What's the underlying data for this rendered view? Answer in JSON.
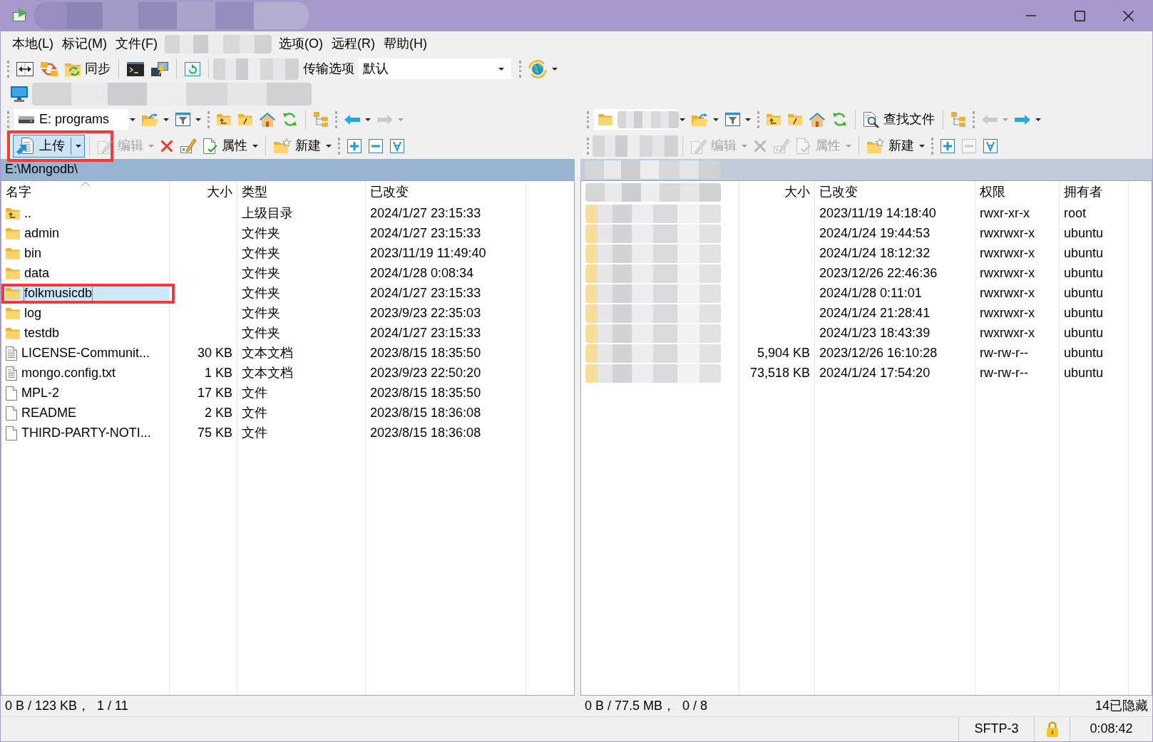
{
  "menu": [
    {
      "kind": "item",
      "label": "本地(L)"
    },
    {
      "kind": "item",
      "label": "标记(M)"
    },
    {
      "kind": "item",
      "label": "文件(F)"
    },
    {
      "kind": "redacted"
    },
    {
      "kind": "item",
      "label": "选项(O)"
    },
    {
      "kind": "item",
      "label": "远程(R)"
    },
    {
      "kind": "item",
      "label": "帮助(H)"
    }
  ],
  "main_toolbar": {
    "sync_label": "同步",
    "transfer_label": "传输选项",
    "transfer_preset": "默认"
  },
  "local_panel": {
    "active": true,
    "nav_toolbar": [
      {
        "kind": "drive",
        "label": "E: programs",
        "disabled": false
      },
      {
        "kind": "open",
        "disabled": false
      },
      {
        "kind": "filter",
        "disabled": false
      },
      {
        "kind": "parent",
        "disabled": false
      },
      {
        "kind": "root",
        "disabled": false
      },
      {
        "kind": "home",
        "disabled": false
      },
      {
        "kind": "refresh",
        "disabled": false
      },
      {
        "kind": "tree",
        "disabled": false
      },
      {
        "kind": "back",
        "disabled": false
      },
      {
        "kind": "forward",
        "disabled": true
      }
    ],
    "action_toolbar": [
      {
        "kind": "upload",
        "label": "上传",
        "disabled": false,
        "pressed": true,
        "marked": true
      },
      {
        "kind": "edit",
        "label": "编辑",
        "disabled": true,
        "pressed": false,
        "marked": false
      },
      {
        "kind": "delete",
        "disabled": false,
        "pressed": false,
        "marked": false
      },
      {
        "kind": "rename",
        "disabled": false,
        "pressed": false,
        "marked": false
      },
      {
        "kind": "properties",
        "label": "属性",
        "disabled": false,
        "pressed": false,
        "marked": false
      },
      {
        "kind": "new",
        "label": "新建",
        "disabled": false,
        "pressed": false,
        "marked": false
      },
      {
        "kind": "select",
        "disabled": false,
        "pressed": false,
        "marked": false
      },
      {
        "kind": "unselect",
        "disabled": false,
        "pressed": false,
        "marked": false
      },
      {
        "kind": "select_all",
        "disabled": false,
        "pressed": false,
        "marked": false
      }
    ],
    "path": "E:\\Mongodb\\",
    "columns": [
      {
        "kind": "text",
        "label": "名字",
        "sorted": true
      },
      {
        "kind": "text",
        "label": "大小",
        "sorted": false
      },
      {
        "kind": "text",
        "label": "类型",
        "sorted": false
      },
      {
        "kind": "text",
        "label": "已改变",
        "sorted": false
      }
    ],
    "rows": [
      {
        "kind": "parent",
        "name": "..",
        "type": "上级目录",
        "changed": "2024/1/27 23:15:33",
        "selected": false,
        "marked": false
      },
      {
        "kind": "folder",
        "name": "admin",
        "type": "文件夹",
        "changed": "2024/1/27 23:15:33",
        "selected": false,
        "marked": false
      },
      {
        "kind": "folder",
        "name": "bin",
        "type": "文件夹",
        "changed": "2023/11/19 11:49:40",
        "selected": false,
        "marked": false
      },
      {
        "kind": "folder",
        "name": "data",
        "type": "文件夹",
        "changed": "2024/1/28 0:08:34",
        "selected": false,
        "marked": false
      },
      {
        "kind": "folder",
        "name": "folkmusicdb",
        "type": "文件夹",
        "changed": "2024/1/27 23:15:33",
        "selected": true,
        "marked": true
      },
      {
        "kind": "folder",
        "name": "log",
        "type": "文件夹",
        "changed": "2023/9/23 22:35:03",
        "selected": false,
        "marked": false
      },
      {
        "kind": "folder",
        "name": "testdb",
        "type": "文件夹",
        "changed": "2024/1/27 23:15:33",
        "selected": false,
        "marked": false
      },
      {
        "kind": "text",
        "name": "LICENSE-Communit...",
        "size": "30 KB",
        "type": "文本文档",
        "changed": "2023/8/15 18:35:50",
        "selected": false,
        "marked": false
      },
      {
        "kind": "text",
        "name": "mongo.config.txt",
        "size": "1 KB",
        "type": "文本文档",
        "changed": "2023/9/23 22:50:20",
        "selected": false,
        "marked": false
      },
      {
        "kind": "file",
        "name": "MPL-2",
        "size": "17 KB",
        "type": "文件",
        "changed": "2023/8/15 18:35:50",
        "selected": false,
        "marked": false
      },
      {
        "kind": "file",
        "name": "README",
        "size": "2 KB",
        "type": "文件",
        "changed": "2023/8/15 18:36:08",
        "selected": false,
        "marked": false
      },
      {
        "kind": "file",
        "name": "THIRD-PARTY-NOTI...",
        "size": "75 KB",
        "type": "文件",
        "changed": "2023/8/15 18:36:08",
        "selected": false,
        "marked": false
      }
    ],
    "status": "0 B / 123 KB，  1 / 11"
  },
  "remote_panel": {
    "active": false,
    "nav_toolbar": [
      {
        "kind": "path",
        "disabled": false
      },
      {
        "kind": "open",
        "disabled": false
      },
      {
        "kind": "filter",
        "disabled": false
      },
      {
        "kind": "parent",
        "disabled": false
      },
      {
        "kind": "root",
        "disabled": false
      },
      {
        "kind": "home",
        "disabled": false
      },
      {
        "kind": "refresh",
        "disabled": false
      },
      {
        "kind": "find",
        "label": "查找文件",
        "disabled": false
      },
      {
        "kind": "tree",
        "disabled": false
      },
      {
        "kind": "back",
        "disabled": true
      },
      {
        "kind": "forward",
        "disabled": false
      }
    ],
    "action_toolbar": [
      {
        "kind": "redacted"
      },
      {
        "kind": "edit",
        "label": "编辑",
        "disabled": true,
        "pressed": false,
        "marked": false
      },
      {
        "kind": "delete",
        "disabled": true,
        "pressed": false,
        "marked": false
      },
      {
        "kind": "rename",
        "disabled": true,
        "pressed": false,
        "marked": false
      },
      {
        "kind": "properties",
        "label": "属性",
        "disabled": true,
        "pressed": false,
        "marked": false
      },
      {
        "kind": "new",
        "label": "新建",
        "disabled": false,
        "pressed": false,
        "marked": false
      },
      {
        "kind": "select",
        "disabled": false,
        "pressed": false,
        "marked": false
      },
      {
        "kind": "unselect",
        "disabled": true,
        "pressed": false,
        "marked": false
      },
      {
        "kind": "select_all",
        "disabled": false,
        "pressed": false,
        "marked": false
      }
    ],
    "columns": [
      {
        "kind": "redacted"
      },
      {
        "kind": "text",
        "label": "大小",
        "sorted": false
      },
      {
        "kind": "text",
        "label": "已改变",
        "sorted": false
      },
      {
        "kind": "text",
        "label": "权限",
        "sorted": false
      },
      {
        "kind": "text",
        "label": "拥有者",
        "sorted": false
      }
    ],
    "rows": [
      {
        "changed": "2023/11/19 14:18:40",
        "permissions": "rwxr-xr-x",
        "owner": "root",
        "selected": false
      },
      {
        "changed": "2024/1/24 19:44:53",
        "permissions": "rwxrwxr-x",
        "owner": "ubuntu",
        "selected": false
      },
      {
        "changed": "2024/1/24 18:12:32",
        "permissions": "rwxrwxr-x",
        "owner": "ubuntu",
        "selected": false
      },
      {
        "changed": "2023/12/26 22:46:36",
        "permissions": "rwxrwxr-x",
        "owner": "ubuntu",
        "selected": false
      },
      {
        "changed": "2024/1/28 0:11:01",
        "permissions": "rwxrwxr-x",
        "owner": "ubuntu",
        "selected": false
      },
      {
        "changed": "2024/1/24 21:28:41",
        "permissions": "rwxrwxr-x",
        "owner": "ubuntu",
        "selected": false
      },
      {
        "changed": "2024/1/23 18:43:39",
        "permissions": "rwxrwxr-x",
        "owner": "ubuntu",
        "selected": false
      },
      {
        "size": "5,904 KB",
        "changed": "2023/12/26 16:10:28",
        "permissions": "rw-rw-r--",
        "owner": "ubuntu",
        "selected": false
      },
      {
        "size": "73,518 KB",
        "changed": "2024/1/24 17:54:20",
        "permissions": "rw-rw-r--",
        "owner": "ubuntu",
        "selected": false
      }
    ],
    "status": "0 B / 77.5 MB，  0 / 8",
    "hidden_count": "14已隐藏"
  },
  "status_bar": {
    "protocol": "SFTP-3",
    "elapsed": "0:08:42"
  }
}
